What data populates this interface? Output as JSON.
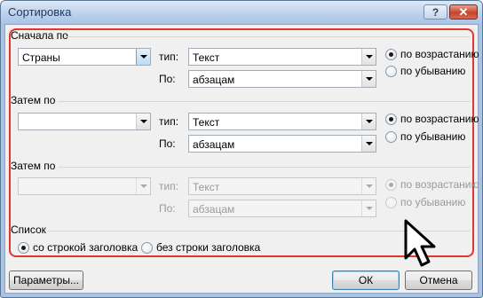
{
  "window": {
    "title": "Сортировка",
    "help_label": "?",
    "close_label": "✕"
  },
  "level1": {
    "heading": "Сначала по",
    "column_value": "Страны",
    "type_label": "тип:",
    "type_value": "Текст",
    "by_label": "По:",
    "by_value": "абзацам",
    "asc_label": "по возрастанию",
    "desc_label": "по убыванию"
  },
  "level2": {
    "heading": "Затем по",
    "column_value": "",
    "type_label": "тип:",
    "type_value": "Текст",
    "by_label": "По:",
    "by_value": "абзацам",
    "asc_label": "по возрастанию",
    "desc_label": "по убыванию"
  },
  "level3": {
    "heading": "Затем по",
    "column_value": "",
    "type_label": "тип:",
    "type_value": "Текст",
    "by_label": "По:",
    "by_value": "абзацам",
    "asc_label": "по возрастанию",
    "desc_label": "по убыванию"
  },
  "list": {
    "heading": "Список",
    "with_header_label": "со строкой заголовка",
    "without_header_label": "без строки заголовка"
  },
  "buttons": {
    "options_label": "Параметры...",
    "ok_label": "ОК",
    "cancel_label": "Отмена"
  },
  "colors": {
    "highlight_border": "#e0382b",
    "title_text": "#1e395b",
    "close_button": "#c8442c"
  },
  "icons": {
    "cursor": "mouse-pointer-icon",
    "dropdown": "chevron-down-icon"
  }
}
